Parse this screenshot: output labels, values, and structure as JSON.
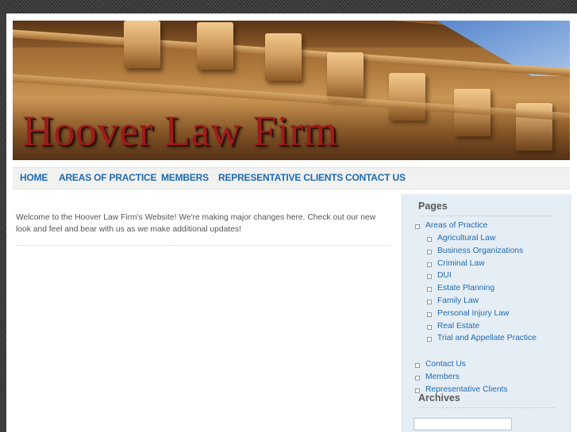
{
  "site": {
    "title": "Hoover Law Firm"
  },
  "nav": {
    "items": [
      {
        "label": "HOME"
      },
      {
        "label": "AREAS OF PRACTICE"
      },
      {
        "label": "MEMBERS"
      },
      {
        "label": "REPRESENTATIVE CLIENTS"
      },
      {
        "label": "CONTACT US"
      }
    ]
  },
  "content": {
    "welcome": "Welcome to the Hoover Law Firm's Website! We're making major changes here. Check out our new look and feel and bear with us as we make additional updates!"
  },
  "sidebar": {
    "pages_title": "Pages",
    "pages": [
      {
        "label": "Areas of Practice"
      },
      {
        "label": "Agricultural Law"
      },
      {
        "label": "Business Organizations"
      },
      {
        "label": "Criminal Law"
      },
      {
        "label": "DUI"
      },
      {
        "label": "Estate Planning"
      },
      {
        "label": "Family Law"
      },
      {
        "label": "Personal Injury Law"
      },
      {
        "label": "Real Estate"
      },
      {
        "label": "Trial and Appellate Practice"
      },
      {
        "label": "Contact Us"
      },
      {
        "label": "Members"
      },
      {
        "label": "Representative Clients"
      }
    ],
    "archives_title": "Archives"
  },
  "colors": {
    "link": "#1d6ab0",
    "title_red": "#9e1c1c",
    "sidebar_bg": "#e6eef5"
  },
  "icons": {
    "list_bullet": "square-bullet-icon"
  }
}
